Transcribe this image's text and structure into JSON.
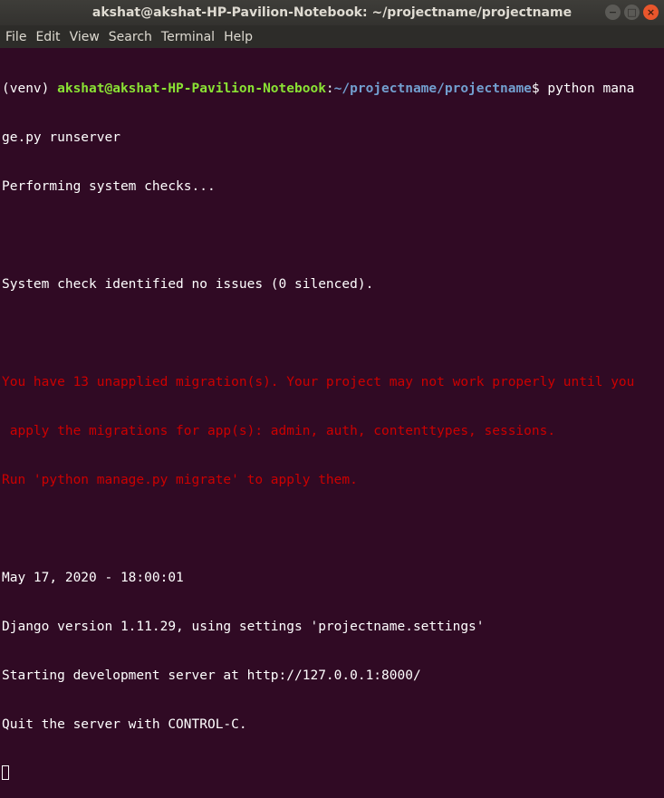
{
  "window": {
    "title": "akshat@akshat-HP-Pavilion-Notebook: ~/projectname/projectname",
    "minimize_glyph": "−",
    "maximize_glyph": "□",
    "close_glyph": "×"
  },
  "menu": [
    "File",
    "Edit",
    "View",
    "Search",
    "Terminal",
    "Help"
  ],
  "terminal": {
    "venv": "(venv) ",
    "user_host": "akshat@akshat-HP-Pavilion-Notebook",
    "colon": ":",
    "path": "~/projectname/projectname",
    "prompt_end": "$ ",
    "command_part1": "python mana",
    "command_part2": "ge.py runserver",
    "line_checks": "Performing system checks...",
    "line_no_issues": "System check identified no issues (0 silenced).",
    "warning_1": "You have 13 unapplied migration(s). Your project may not work properly until you",
    "warning_2": " apply the migrations for app(s): admin, auth, contenttypes, sessions.",
    "warning_3": "Run 'python manage.py migrate' to apply them.",
    "date_line": "May 17, 2020 - 18:00:01",
    "version_line": "Django version 1.11.29, using settings 'projectname.settings'",
    "server_line": "Starting development server at http://127.0.0.1:8000/",
    "quit_line": "Quit the server with CONTROL-C."
  },
  "colors": {
    "background": "#300a24",
    "prompt_user": "#8ae234",
    "prompt_path": "#729fcf",
    "warning": "#cc0000",
    "text": "#ffffff"
  }
}
